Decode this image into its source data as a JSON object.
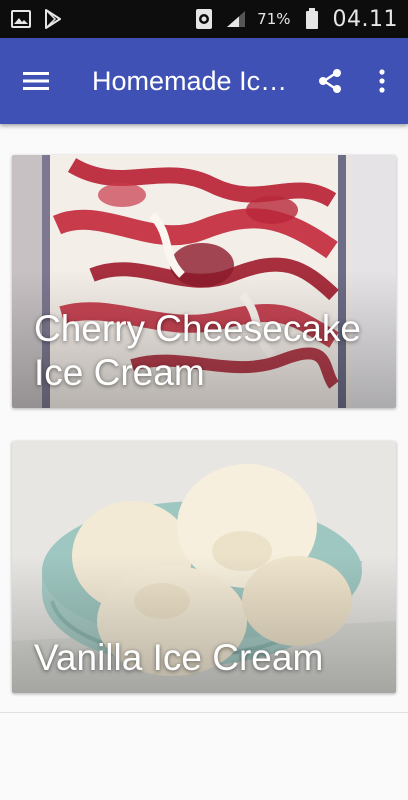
{
  "status_bar": {
    "battery_percent": "71%",
    "time": "04.11",
    "left_icons": [
      "image-icon",
      "play-store-icon"
    ],
    "right_icons": [
      "data-saver-icon",
      "signal-icon",
      "battery-icon"
    ]
  },
  "app_bar": {
    "title": "Homemade Ice…",
    "background_color": "#3f51b5",
    "icons": [
      "menu-icon",
      "share-icon",
      "more-vert-icon"
    ]
  },
  "recipes": [
    {
      "title": "Cherry Cheesecake Ice Cream"
    },
    {
      "title": "Vanilla Ice Cream"
    }
  ]
}
